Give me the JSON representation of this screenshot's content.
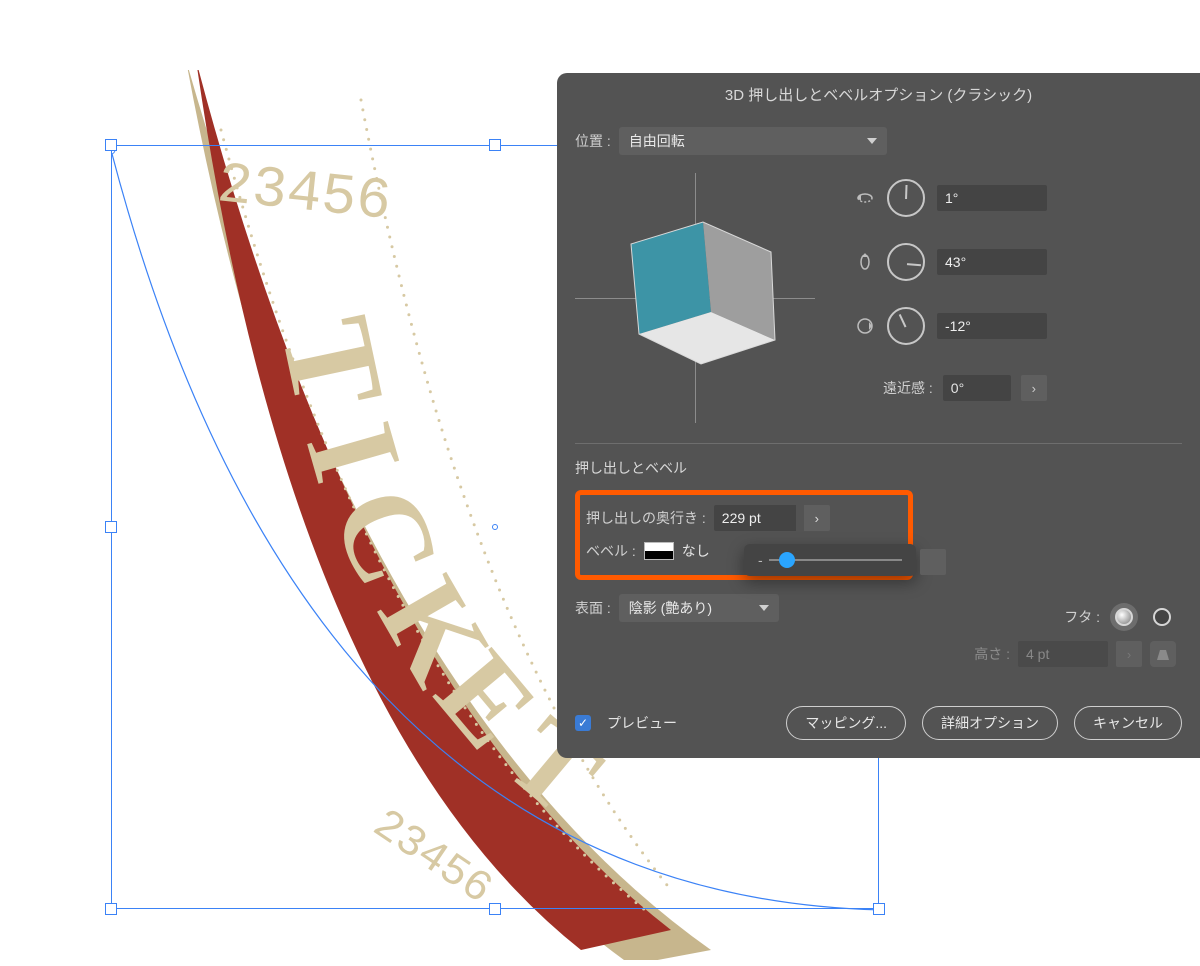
{
  "dialog": {
    "title": "3D 押し出しとベベルオプション (クラシック)",
    "position_label": "位置 :",
    "position_value": "自由回転",
    "rotation": {
      "x": "1°",
      "y": "43°",
      "z": "-12°"
    },
    "perspective_label": "遠近感 :",
    "perspective_value": "0°",
    "section_extrude": "押し出しとベベル",
    "depth_label": "押し出しの奥行き :",
    "depth_value": "229 pt",
    "bevel_label": "ベベル :",
    "bevel_value": "なし",
    "cap_label": "フタ :",
    "height_label": "高さ :",
    "height_value": "4 pt",
    "surface_label": "表面 :",
    "surface_value": "陰影 (艶あり)",
    "preview_label": "プレビュー",
    "buttons": {
      "mapping": "マッピング...",
      "more": "詳細オプション",
      "cancel": "キャンセル"
    }
  },
  "artwork": {
    "text_main": "TICKET",
    "text_number": "23456"
  }
}
